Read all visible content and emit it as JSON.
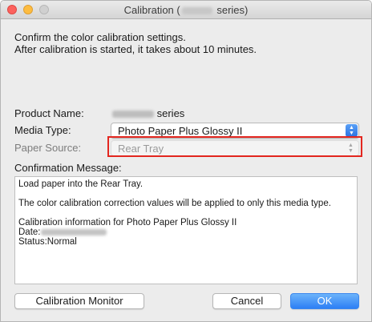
{
  "window": {
    "title_prefix": "Calibration (",
    "title_suffix": " series)"
  },
  "intro": {
    "line1": "Confirm the color calibration settings.",
    "line2": "After calibration is started, it takes about 10 minutes."
  },
  "product": {
    "label": "Product Name:",
    "value_suffix": "series"
  },
  "media_type": {
    "label": "Media Type:",
    "value": "Photo Paper Plus Glossy II",
    "enabled": true
  },
  "paper_source": {
    "label": "Paper Source:",
    "value": "Rear Tray",
    "enabled": false,
    "highlight_color": "#e3261f"
  },
  "confirmation": {
    "label": "Confirmation Message:",
    "line1": "Load paper into the Rear Tray.",
    "line2": "The color calibration correction values will be applied to only this media type.",
    "line3": "Calibration information for Photo Paper Plus Glossy II",
    "date_label": " Date:",
    "status_line": " Status:Normal"
  },
  "buttons": {
    "calibration_monitor": "Calibration Monitor",
    "cancel": "Cancel",
    "ok": "OK"
  },
  "colors": {
    "accent": "#2d7ff5",
    "window_bg": "#ececec"
  },
  "icons": {
    "close": "close-icon",
    "minimize": "minimize-icon",
    "zoom": "zoom-icon",
    "popup_arrows": "updown-chevron-icon"
  }
}
